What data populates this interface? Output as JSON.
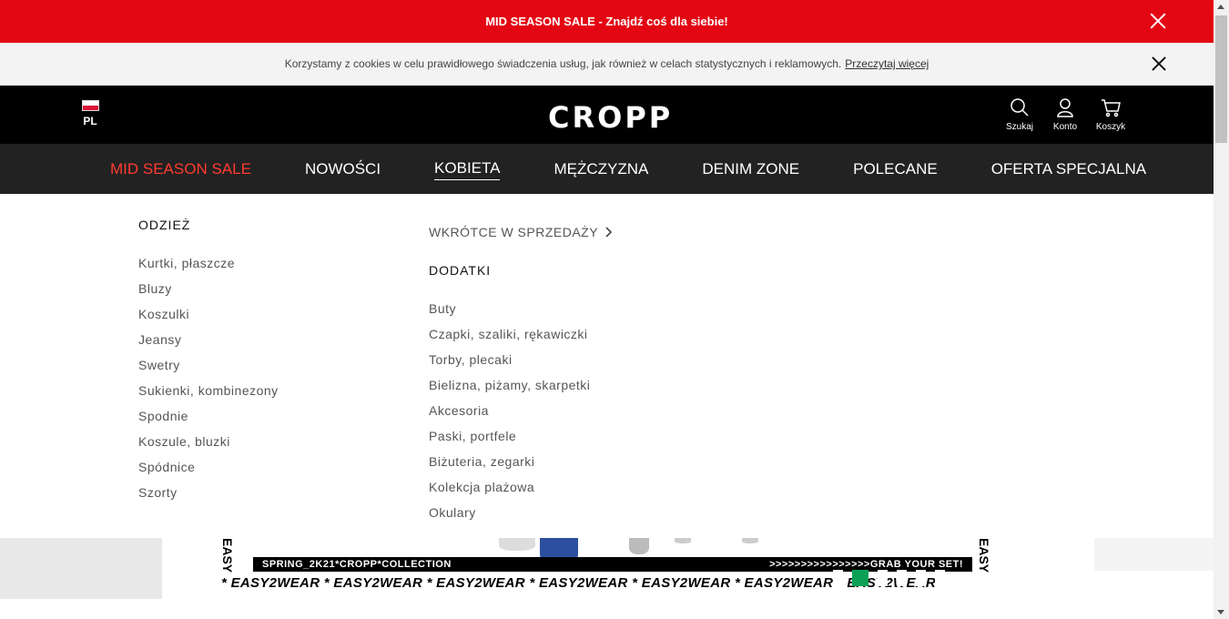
{
  "promo": {
    "text": "MID SEASON SALE - Znajdź coś dla siebie!",
    "close_icon": "close-icon",
    "bg": "#e30613"
  },
  "cookies": {
    "text": "Korzystamy z cookies w celu prawidłowego świadczenia usług, jak również w celach statystycznych i reklamowych.",
    "link": "Przeczytaj więcej"
  },
  "header": {
    "lang": "PL",
    "logo": "CROPP",
    "tools": [
      {
        "label": "Szukaj",
        "icon": "search-icon"
      },
      {
        "label": "Konto",
        "icon": "user-icon"
      },
      {
        "label": "Koszyk",
        "icon": "cart-icon"
      }
    ]
  },
  "nav": {
    "items": [
      "MID SEASON SALE",
      "NOWOŚCI",
      "KOBIETA",
      "MĘŻCZYZNA",
      "DENIM ZONE",
      "POLECANE",
      "OFERTA SPECJALNA"
    ],
    "active": "KOBIETA",
    "sale_color": "#ff3b30"
  },
  "mega": {
    "odziez": {
      "heading": "ODZIEŻ",
      "links": [
        "Kurtki, płaszcze",
        "Bluzy",
        "Koszulki",
        "Jeansy",
        "Swetry",
        "Sukienki, kombinezony",
        "Spodnie",
        "Koszule, bluzki",
        "Spódnice",
        "Szorty"
      ]
    },
    "soon": "WKRÓTCE W SPRZEDAŻY",
    "dodatki": {
      "heading": "DODATKI",
      "links": [
        "Buty",
        "Czapki, szaliki, rękawiczki",
        "Torby, plecaki",
        "Bielizna, piżamy, skarpetki",
        "Akcesoria",
        "Paski, portfele",
        "Biżuteria, zegarki",
        "Kolekcja plażowa",
        "Okulary"
      ]
    }
  },
  "banner": {
    "strip_left": "SPRING_2K21*CROPP*COLLECTION",
    "strip_right": ">>>>>>>>>>>>>>>>GRAB YOUR SET!",
    "repeat": "* EASY2WEAR * EASY2WEAR * EASY2WEAR * EASY2WEAR * EASY2WEAR * EASY2WEAR * EASY2WEAR",
    "side": "EASY",
    "accent": "#0aa157"
  }
}
